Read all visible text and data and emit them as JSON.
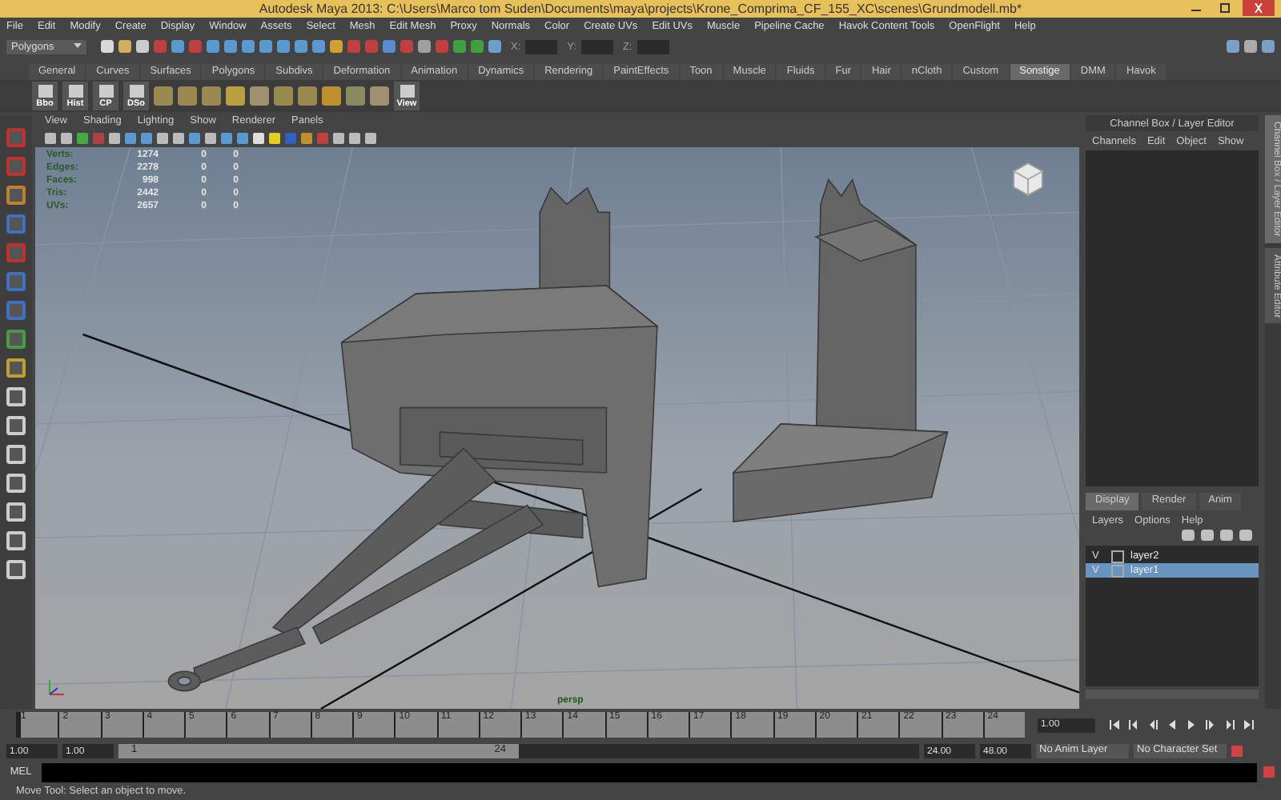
{
  "window": {
    "title": "Autodesk Maya 2013: C:\\Users\\Marco tom Suden\\Documents\\maya\\projects\\Krone_Comprima_CF_155_XC\\scenes\\Grundmodell.mb*"
  },
  "menu": [
    "File",
    "Edit",
    "Modify",
    "Create",
    "Display",
    "Window",
    "Assets",
    "Select",
    "Mesh",
    "Edit Mesh",
    "Proxy",
    "Normals",
    "Color",
    "Create UVs",
    "Edit UVs",
    "Muscle",
    "Pipeline Cache",
    "Havok Content Tools",
    "OpenFlight",
    "Help"
  ],
  "status_line": {
    "mode": "Polygons",
    "fields": [
      {
        "label": "X:"
      },
      {
        "label": "Y:"
      },
      {
        "label": "Z:"
      }
    ]
  },
  "shelf": {
    "tabs": [
      {
        "label": "General",
        "selected": false
      },
      {
        "label": "Curves",
        "selected": false
      },
      {
        "label": "Surfaces",
        "selected": false
      },
      {
        "label": "Polygons",
        "selected": false
      },
      {
        "label": "Subdivs",
        "selected": false
      },
      {
        "label": "Deformation",
        "selected": false
      },
      {
        "label": "Animation",
        "selected": false
      },
      {
        "label": "Dynamics",
        "selected": false
      },
      {
        "label": "Rendering",
        "selected": false
      },
      {
        "label": "PaintEffects",
        "selected": false
      },
      {
        "label": "Toon",
        "selected": false
      },
      {
        "label": "Muscle",
        "selected": false
      },
      {
        "label": "Fluids",
        "selected": false
      },
      {
        "label": "Fur",
        "selected": false
      },
      {
        "label": "Hair",
        "selected": false
      },
      {
        "label": "nCloth",
        "selected": false
      },
      {
        "label": "Custom",
        "selected": false
      },
      {
        "label": "Sonstige",
        "selected": true
      },
      {
        "label": "DMM",
        "selected": false
      },
      {
        "label": "Havok",
        "selected": false
      }
    ],
    "leading_buttons": [
      "Bbo",
      "Hist",
      "CP",
      "DSo"
    ],
    "trailing_buttons": [
      "View"
    ]
  },
  "viewport": {
    "menu": [
      "View",
      "Shading",
      "Lighting",
      "Show",
      "Renderer",
      "Panels"
    ],
    "hud": [
      {
        "label": "Verts:",
        "values": [
          "1274",
          "0",
          "0"
        ]
      },
      {
        "label": "Edges:",
        "values": [
          "2278",
          "0",
          "0"
        ]
      },
      {
        "label": "Faces:",
        "values": [
          "998",
          "0",
          "0"
        ]
      },
      {
        "label": "Tris:",
        "values": [
          "2442",
          "0",
          "0"
        ]
      },
      {
        "label": "UVs:",
        "values": [
          "2657",
          "0",
          "0"
        ]
      }
    ],
    "camera": "persp"
  },
  "channel_box": {
    "title": "Channel Box / Layer Editor",
    "menu": [
      "Channels",
      "Edit",
      "Object",
      "Show"
    ]
  },
  "side_tabs": [
    "Channel Box / Layer Editor",
    "Attribute Editor"
  ],
  "layer_editor": {
    "tabs": [
      {
        "label": "Display",
        "selected": true
      },
      {
        "label": "Render",
        "selected": false
      },
      {
        "label": "Anim",
        "selected": false
      }
    ],
    "menu": [
      "Layers",
      "Options",
      "Help"
    ],
    "layers": [
      {
        "visibility": "V",
        "name": "layer2",
        "selected": false
      },
      {
        "visibility": "V",
        "name": "layer1",
        "selected": true
      }
    ]
  },
  "timeline": {
    "ticks": [
      "1",
      "2",
      "3",
      "4",
      "5",
      "6",
      "7",
      "8",
      "9",
      "10",
      "11",
      "12",
      "13",
      "14",
      "15",
      "16",
      "17",
      "18",
      "19",
      "20",
      "21",
      "22",
      "23",
      "24"
    ],
    "current_frame": "1.00",
    "level": 0
  },
  "range": {
    "start": "1.00",
    "playback_start": "1.00",
    "slider_start": "1",
    "slider_end": "24",
    "playback_end": "24.00",
    "end": "48.00",
    "anim_layer": "No Anim Layer",
    "character_set": "No Character Set",
    "level": 0.5
  },
  "command_line": {
    "label": "MEL"
  },
  "help_line": "Move Tool: Select an object to move."
}
